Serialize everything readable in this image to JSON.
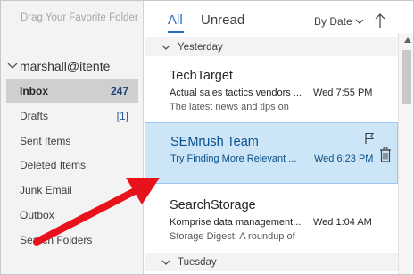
{
  "folder_pane": {
    "favorites_hint": "Drag Your Favorite Folder",
    "account_name": "marshall@itente",
    "folders": [
      {
        "name": "Inbox",
        "count": "247",
        "active": true
      },
      {
        "name": "Drafts",
        "count": "[1]"
      },
      {
        "name": "Sent Items",
        "count": ""
      },
      {
        "name": "Deleted Items",
        "count": ""
      },
      {
        "name": "Junk Email",
        "count": ""
      },
      {
        "name": "Outbox",
        "count": ""
      },
      {
        "name": "Search Folders",
        "count": ""
      }
    ]
  },
  "message_list": {
    "tabs": {
      "all": "All",
      "unread": "Unread"
    },
    "sort_label": "By Date",
    "groups": {
      "yesterday": "Yesterday",
      "tuesday": "Tuesday"
    },
    "messages": [
      {
        "sender": "TechTarget",
        "subject": "Actual sales tactics vendors ...",
        "time": "Wed 7:55 PM",
        "preview": "The latest news and tips on"
      },
      {
        "sender": "SEMrush Team",
        "subject": "Try Finding More Relevant ...",
        "time": "Wed 6:23 PM",
        "preview": "",
        "selected": true
      },
      {
        "sender": "SearchStorage",
        "subject": "Komprise data management...",
        "time": "Wed 1:04 AM",
        "preview": "Storage Digest: A roundup of"
      }
    ]
  },
  "colors": {
    "accent": "#2b6cc4",
    "selected_background": "#cde6f7",
    "annotation_arrow": "#e8121c"
  },
  "icons": {
    "account_toggle": "chevron-down-icon",
    "group_toggle": "chevron-down-icon",
    "sort_order": "arrow-up-icon",
    "flag": "flag-icon",
    "delete": "trash-icon",
    "scroll_up": "triangle-up-icon",
    "annotation": "red-arrow-pointer"
  }
}
